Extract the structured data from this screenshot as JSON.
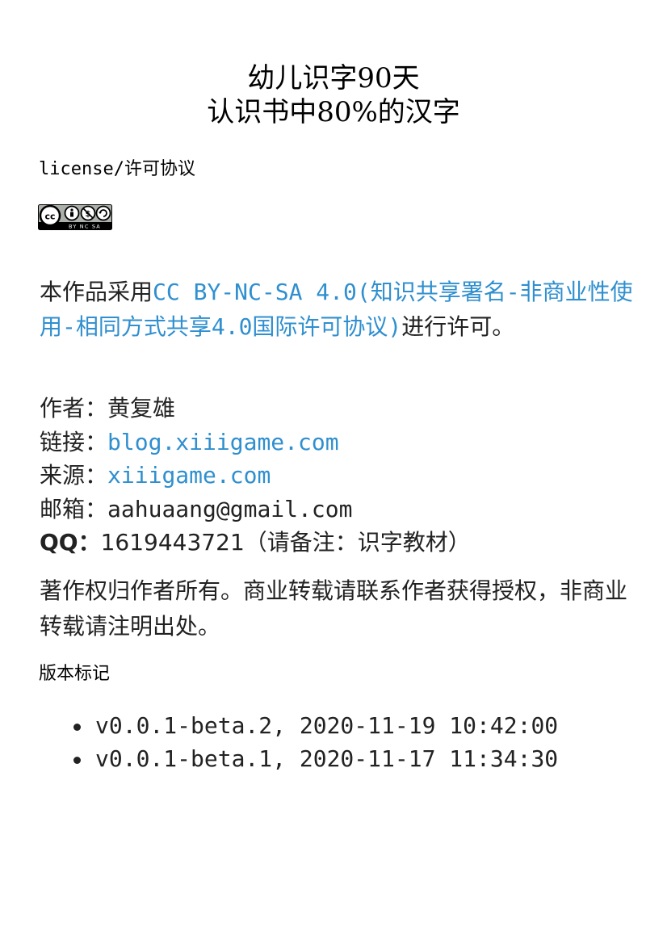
{
  "title": {
    "line1": "幼儿识字90天",
    "line2": "认识书中80%的汉字"
  },
  "license": {
    "heading": "license/许可协议",
    "badge_label": "BY NC SA",
    "text_prefix": "本作品采用",
    "link_text": "CC BY-NC-SA 4.0(知识共享署名-非商业性使用-相同方式共享4.0国际许可协议)",
    "text_suffix": "进行许可。"
  },
  "info": {
    "author_label": "作者：",
    "author": "黄复雄",
    "link_label": "链接：",
    "link": "blog.xiiigame.com",
    "source_label": "来源：",
    "source": "xiiigame.com",
    "email_label": "邮箱：",
    "email": "aahuaang@gmail.com",
    "qq_label": "QQ：",
    "qq_number": "1619443721",
    "qq_note": "（请备注：识字教材）"
  },
  "copyright": "著作权归作者所有。商业转载请联系作者获得授权，非商业转载请注明出处。",
  "versions": {
    "heading": "版本标记",
    "items": [
      "v0.0.1-beta.2, 2020-11-19 10:42:00",
      "v0.0.1-beta.1, 2020-11-17 11:34:30"
    ]
  },
  "colors": {
    "link": "#2f8fcf",
    "text": "#222222"
  }
}
